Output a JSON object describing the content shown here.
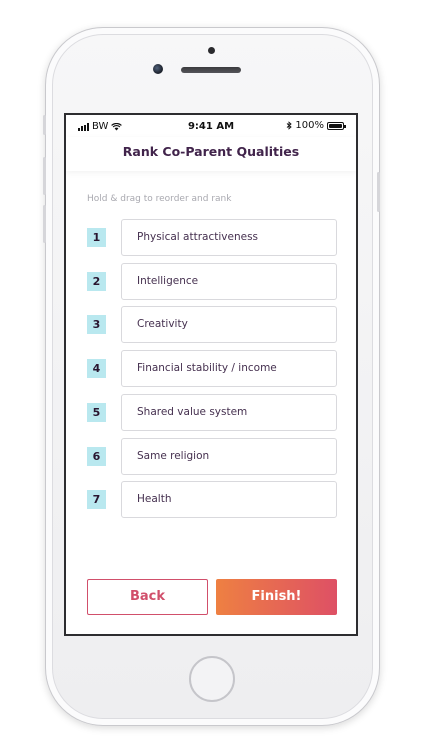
{
  "status_bar": {
    "carrier": "BW",
    "time": "9:41 AM",
    "battery": "100%",
    "battery_level": 1.0
  },
  "header": {
    "title": "Rank Co-Parent Qualities"
  },
  "instructions": "Hold & drag to reorder and rank",
  "ranking": [
    {
      "rank": "1",
      "label": "Physical attractiveness"
    },
    {
      "rank": "2",
      "label": "Intelligence"
    },
    {
      "rank": "3",
      "label": "Creativity"
    },
    {
      "rank": "4",
      "label": "Financial stability / income"
    },
    {
      "rank": "5",
      "label": "Shared value system"
    },
    {
      "rank": "6",
      "label": "Same religion"
    },
    {
      "rank": "7",
      "label": "Health"
    }
  ],
  "actions": {
    "back_label": "Back",
    "finish_label": "Finish!"
  },
  "colors": {
    "accent": "#d14f6b",
    "gradient_start": "#ee8042",
    "gradient_end": "#de5065",
    "rank_badge": "#b9e8ef",
    "title": "#41244b"
  }
}
